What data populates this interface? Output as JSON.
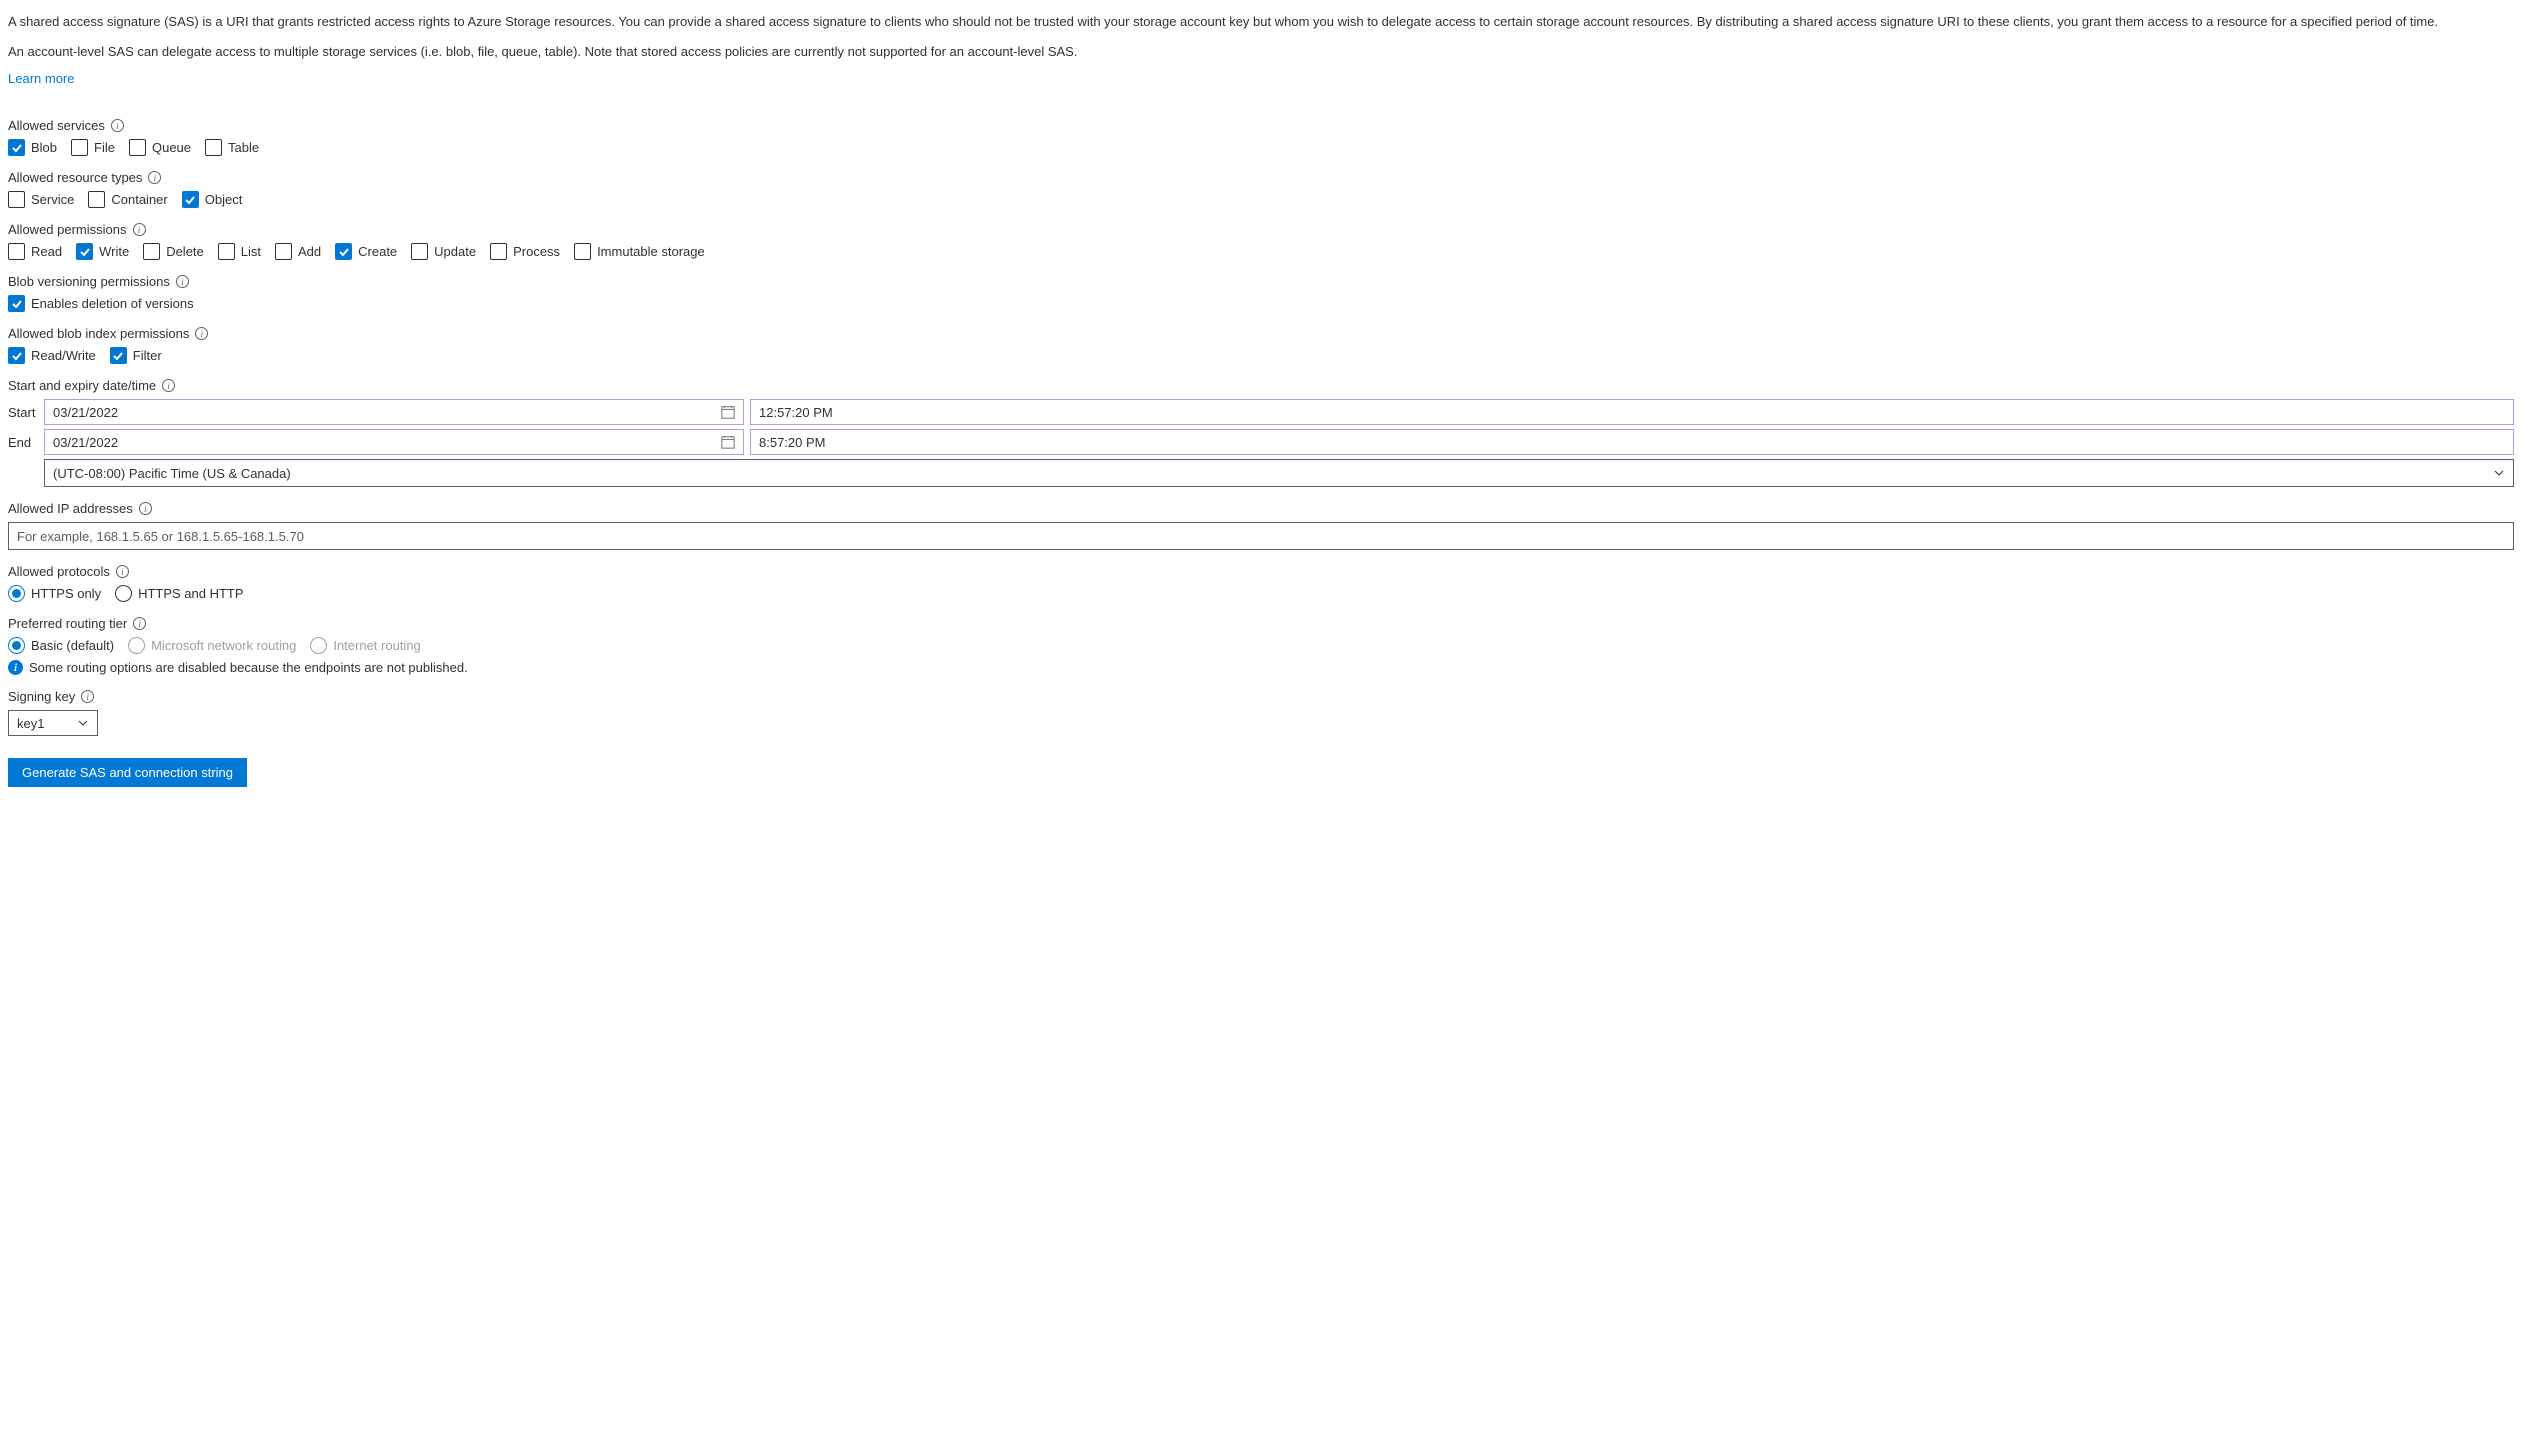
{
  "description1": "A shared access signature (SAS) is a URI that grants restricted access rights to Azure Storage resources. You can provide a shared access signature to clients who should not be trusted with your storage account key but whom you wish to delegate access to certain storage account resources. By distributing a shared access signature URI to these clients, you grant them access to a resource for a specified period of time.",
  "description2": "An account-level SAS can delegate access to multiple storage services (i.e. blob, file, queue, table). Note that stored access policies are currently not supported for an account-level SAS.",
  "learn_more": "Learn more",
  "services": {
    "label": "Allowed services",
    "options": [
      {
        "label": "Blob",
        "checked": true
      },
      {
        "label": "File",
        "checked": false
      },
      {
        "label": "Queue",
        "checked": false
      },
      {
        "label": "Table",
        "checked": false
      }
    ]
  },
  "resource_types": {
    "label": "Allowed resource types",
    "options": [
      {
        "label": "Service",
        "checked": false
      },
      {
        "label": "Container",
        "checked": false
      },
      {
        "label": "Object",
        "checked": true
      }
    ]
  },
  "permissions": {
    "label": "Allowed permissions",
    "options": [
      {
        "label": "Read",
        "checked": false
      },
      {
        "label": "Write",
        "checked": true
      },
      {
        "label": "Delete",
        "checked": false
      },
      {
        "label": "List",
        "checked": false
      },
      {
        "label": "Add",
        "checked": false
      },
      {
        "label": "Create",
        "checked": true
      },
      {
        "label": "Update",
        "checked": false
      },
      {
        "label": "Process",
        "checked": false
      },
      {
        "label": "Immutable storage",
        "checked": false
      }
    ]
  },
  "blob_versioning": {
    "label": "Blob versioning permissions",
    "options": [
      {
        "label": "Enables deletion of versions",
        "checked": true
      }
    ]
  },
  "blob_index": {
    "label": "Allowed blob index permissions",
    "options": [
      {
        "label": "Read/Write",
        "checked": true
      },
      {
        "label": "Filter",
        "checked": true
      }
    ]
  },
  "datetime": {
    "label": "Start and expiry date/time",
    "start_label": "Start",
    "end_label": "End",
    "start_date": "03/21/2022",
    "start_time": "12:57:20 PM",
    "end_date": "03/21/2022",
    "end_time": "8:57:20 PM",
    "timezone": "(UTC-08:00) Pacific Time (US & Canada)"
  },
  "ip": {
    "label": "Allowed IP addresses",
    "placeholder": "For example, 168.1.5.65 or 168.1.5.65-168.1.5.70"
  },
  "protocols": {
    "label": "Allowed protocols",
    "options": [
      {
        "label": "HTTPS only",
        "selected": true
      },
      {
        "label": "HTTPS and HTTP",
        "selected": false
      }
    ]
  },
  "routing": {
    "label": "Preferred routing tier",
    "options": [
      {
        "label": "Basic (default)",
        "selected": true,
        "disabled": false
      },
      {
        "label": "Microsoft network routing",
        "selected": false,
        "disabled": true
      },
      {
        "label": "Internet routing",
        "selected": false,
        "disabled": true
      }
    ],
    "note": "Some routing options are disabled because the endpoints are not published."
  },
  "signing_key": {
    "label": "Signing key",
    "value": "key1"
  },
  "generate_button": "Generate SAS and connection string"
}
